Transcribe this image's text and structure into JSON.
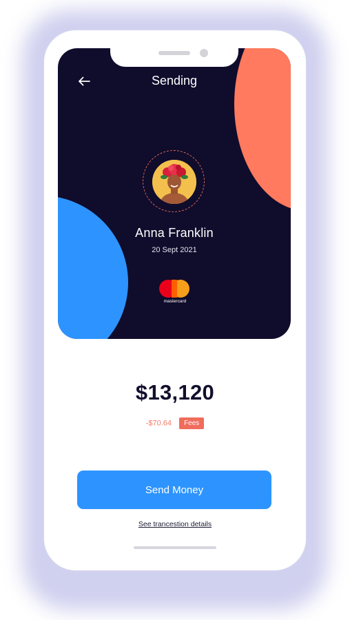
{
  "header": {
    "title": "Sending"
  },
  "recipient": {
    "name": "Anna Franklin",
    "date": "20 Sept 2021"
  },
  "card": {
    "brand_label": "mastercard"
  },
  "transfer": {
    "amount": "$13,120",
    "fee_amount": "-$70.64",
    "fee_label": "Fees"
  },
  "actions": {
    "send_label": "Send Money",
    "details_link": "See trancestion details"
  },
  "colors": {
    "card_bg": "#100c2c",
    "accent_blue": "#2d94ff",
    "accent_orange": "#ff7a5e",
    "fee_red": "#f06c5c"
  },
  "icons": {
    "back": "arrow-left-icon",
    "card_logo": "mastercard-logo-icon"
  }
}
